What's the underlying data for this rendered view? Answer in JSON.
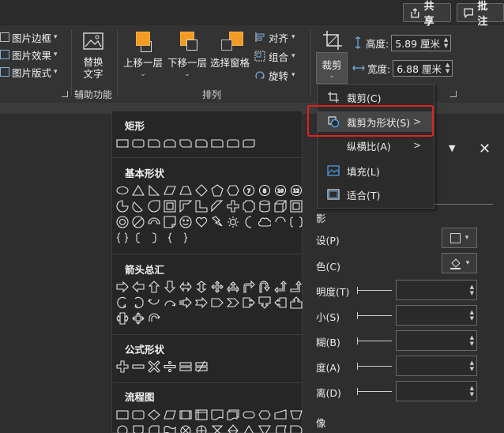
{
  "header": {
    "share_label": "共享",
    "comment_label": "批注"
  },
  "picture_group": {
    "items": [
      {
        "label": "图片边框",
        "icon": "picture-border-icon"
      },
      {
        "label": "图片效果",
        "icon": "picture-effects-icon"
      },
      {
        "label": "图片版式",
        "icon": "picture-layout-icon"
      }
    ]
  },
  "accessibility_group": {
    "button_line1": "替换",
    "button_line2": "文字",
    "group_label": "辅助功能"
  },
  "arrange_group": {
    "bring_forward": "上移一层",
    "send_backward": "下移一层",
    "selection_pane": "选择窗格",
    "align": "对齐",
    "group": "组合",
    "rotate": "旋转",
    "group_label": "排列"
  },
  "size_group": {
    "crop_button": "裁剪",
    "height_label": "高度:",
    "height_value": "5.89 厘米",
    "width_label": "宽度:",
    "width_value": "6.88 厘米"
  },
  "crop_menu": {
    "items": [
      {
        "label": "裁剪(C)",
        "icon": "crop-icon",
        "submenu": false
      },
      {
        "label": "裁剪为形状(S)",
        "icon": "crop-to-shape-icon",
        "submenu": true,
        "highlighted": true
      },
      {
        "label": "纵横比(A)",
        "icon": "",
        "submenu": true
      },
      {
        "label": "填充(L)",
        "icon": "fill-icon",
        "submenu": false
      },
      {
        "label": "适合(T)",
        "icon": "fit-icon",
        "submenu": false
      }
    ]
  },
  "shape_gallery": {
    "sections": [
      {
        "title": "矩形"
      },
      {
        "title": "基本形状"
      },
      {
        "title": "箭头总汇"
      },
      {
        "title": "公式形状"
      },
      {
        "title": "流程图"
      }
    ]
  },
  "format_pane": {
    "labels": [
      "影",
      "设(P)",
      "色(C)",
      "明度(T)",
      "小(S)",
      "糊(B)",
      "度(A)",
      "离(D)",
      "像"
    ]
  },
  "colors": {
    "accent_orange": "#f29c23",
    "highlight_red": "#e02020",
    "ribbon_bg": "#333333"
  }
}
